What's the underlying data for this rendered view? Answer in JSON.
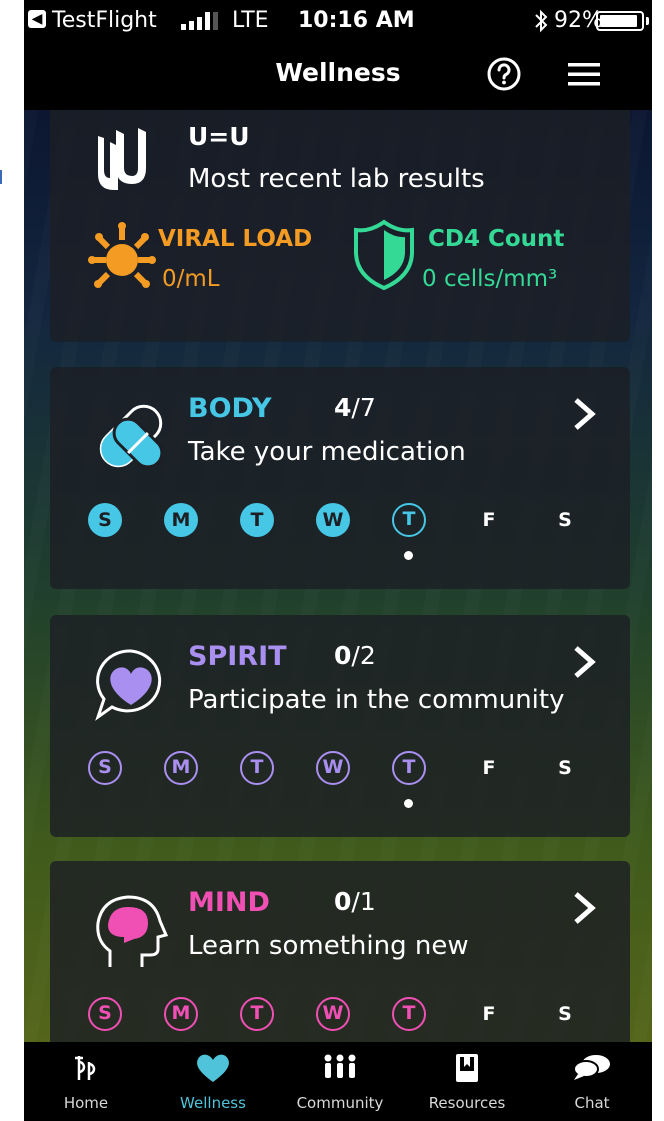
{
  "status_bar": {
    "back_app": "TestFlight",
    "network": "LTE",
    "time": "10:16 AM",
    "battery": "92%",
    "battery_level": 0.92
  },
  "header": {
    "title": "Wellness",
    "help_icon": "question-circle-icon",
    "menu_icon": "hamburger-menu-icon"
  },
  "lab_card": {
    "title": "U=U",
    "subtitle": "Most recent lab results",
    "viral_load": {
      "label": "VIRAL LOAD",
      "value": "0/mL",
      "color": "#f39b23"
    },
    "cd4": {
      "label": "CD4 Count",
      "value": "0 cells/mm³",
      "color": "#35d996"
    }
  },
  "categories": [
    {
      "id": "body",
      "title": "BODY",
      "done": "4",
      "total": "/7",
      "subtitle": "Take your medication",
      "color": "#46c7e6",
      "icon": "pill-icon",
      "days": [
        {
          "letter": "S",
          "state": "filled"
        },
        {
          "letter": "M",
          "state": "filled"
        },
        {
          "letter": "T",
          "state": "filled"
        },
        {
          "letter": "W",
          "state": "filled"
        },
        {
          "letter": "T",
          "state": "outline"
        },
        {
          "letter": "F",
          "state": "plain"
        },
        {
          "letter": "S",
          "state": "plain"
        }
      ],
      "today_index": 4
    },
    {
      "id": "spirit",
      "title": "SPIRIT",
      "done": "0",
      "total": "/2",
      "subtitle": "Participate in the community",
      "color": "#a98ff0",
      "icon": "heart-speech-bubble-icon",
      "days": [
        {
          "letter": "S",
          "state": "outline"
        },
        {
          "letter": "M",
          "state": "outline"
        },
        {
          "letter": "T",
          "state": "outline"
        },
        {
          "letter": "W",
          "state": "outline"
        },
        {
          "letter": "T",
          "state": "outline"
        },
        {
          "letter": "F",
          "state": "plain"
        },
        {
          "letter": "S",
          "state": "plain"
        }
      ],
      "today_index": 4
    },
    {
      "id": "mind",
      "title": "MIND",
      "done": "0",
      "total": "/1",
      "subtitle": "Learn something new",
      "color": "#f04fb4",
      "icon": "brain-head-icon",
      "days": [
        {
          "letter": "S",
          "state": "outline"
        },
        {
          "letter": "M",
          "state": "outline"
        },
        {
          "letter": "T",
          "state": "outline"
        },
        {
          "letter": "W",
          "state": "outline"
        },
        {
          "letter": "T",
          "state": "outline"
        },
        {
          "letter": "F",
          "state": "plain"
        },
        {
          "letter": "S",
          "state": "plain"
        }
      ],
      "today_index": null
    }
  ],
  "tabbar": {
    "active": "wellness",
    "items": [
      {
        "id": "home",
        "label": "Home",
        "icon": "pp-logo-icon"
      },
      {
        "id": "wellness",
        "label": "Wellness",
        "icon": "heart-icon"
      },
      {
        "id": "community",
        "label": "Community",
        "icon": "people-group-icon"
      },
      {
        "id": "resources",
        "label": "Resources",
        "icon": "book-icon"
      },
      {
        "id": "chat",
        "label": "Chat",
        "icon": "chat-bubbles-icon"
      }
    ]
  },
  "colors": {
    "accent": "#4fc3d9",
    "tab_bar": "#000000",
    "card": "#1c1e24"
  }
}
